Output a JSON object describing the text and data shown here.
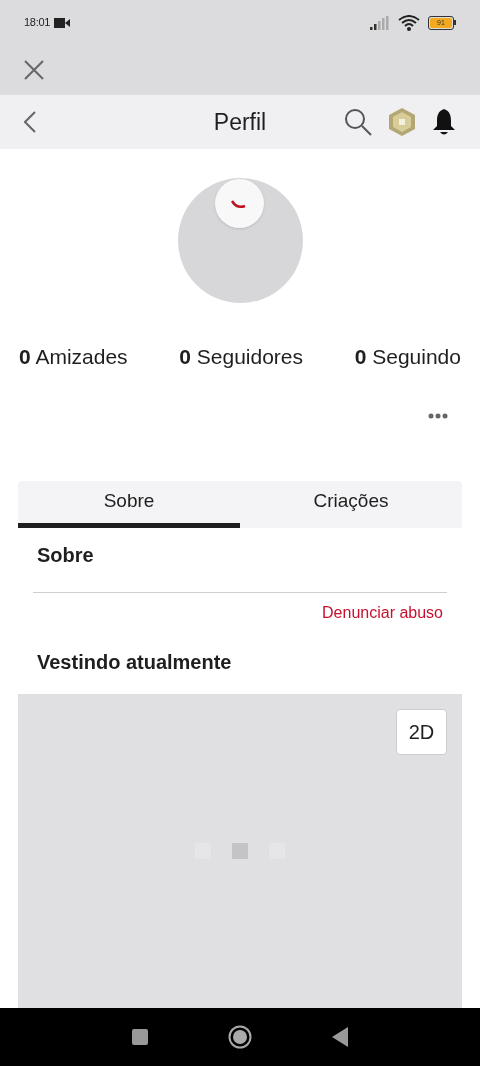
{
  "status_bar": {
    "time": "18:01",
    "battery": "91"
  },
  "header": {
    "title": "Perfil"
  },
  "stats": [
    {
      "count": "0",
      "label": "Amizades"
    },
    {
      "count": "0",
      "label": "Seguidores"
    },
    {
      "count": "0",
      "label": "Seguindo"
    }
  ],
  "tabs": [
    {
      "label": "Sobre",
      "selected": true
    },
    {
      "label": "Criações",
      "selected": false
    }
  ],
  "about": {
    "heading": "Sobre",
    "report_link": "Denunciar abuso"
  },
  "wearing": {
    "heading": "Vestindo atualmente",
    "toggle": "2D"
  }
}
